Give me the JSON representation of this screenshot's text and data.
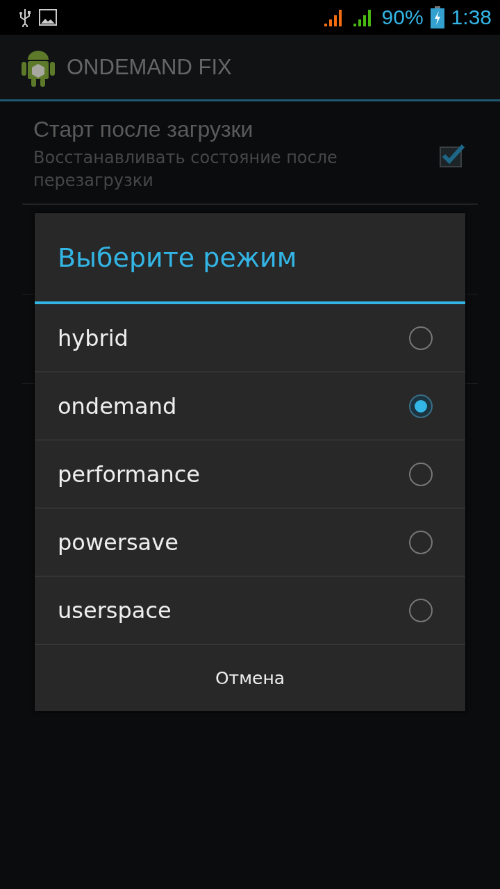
{
  "status_bar": {
    "battery": "90%",
    "time": "1:38"
  },
  "action_bar": {
    "title": "ONDEMAND FIX"
  },
  "preferences": [
    {
      "title": "Старт после загрузки",
      "summary": "Восстанавливать состояние после перезагрузки",
      "checked": true
    }
  ],
  "dialog": {
    "title": "Выберите режим",
    "options": [
      {
        "label": "hybrid",
        "selected": false
      },
      {
        "label": "ondemand",
        "selected": true
      },
      {
        "label": "performance",
        "selected": false
      },
      {
        "label": "powersave",
        "selected": false
      },
      {
        "label": "userspace",
        "selected": false
      }
    ],
    "cancel": "Отмена"
  }
}
